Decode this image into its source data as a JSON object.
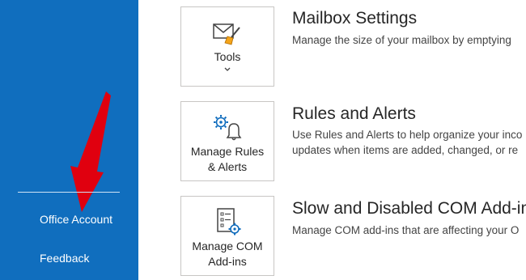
{
  "sidebar": {
    "items": [
      {
        "label": "Office Account"
      },
      {
        "label": "Feedback"
      }
    ]
  },
  "colors": {
    "sidebar_bg": "#106ebe",
    "arrow": "#e0000f",
    "text": "#262626",
    "icon_accent": "#0f6cbd"
  },
  "sections": [
    {
      "tile_label": "Tools",
      "tile_icon": "mailbox-cleanup-icon",
      "title": "Mailbox Settings",
      "description": "Manage the size of your mailbox by emptying"
    },
    {
      "tile_label": "Manage Rules\n& Alerts",
      "tile_icon": "rules-alerts-icon",
      "title": "Rules and Alerts",
      "description": "Use Rules and Alerts to help organize your inco\nupdates when items are added, changed, or re"
    },
    {
      "tile_label": "Manage COM\nAdd-ins",
      "tile_icon": "com-addins-icon",
      "title": "Slow and Disabled COM Add-in",
      "description": "Manage COM add-ins that are affecting your O"
    }
  ]
}
